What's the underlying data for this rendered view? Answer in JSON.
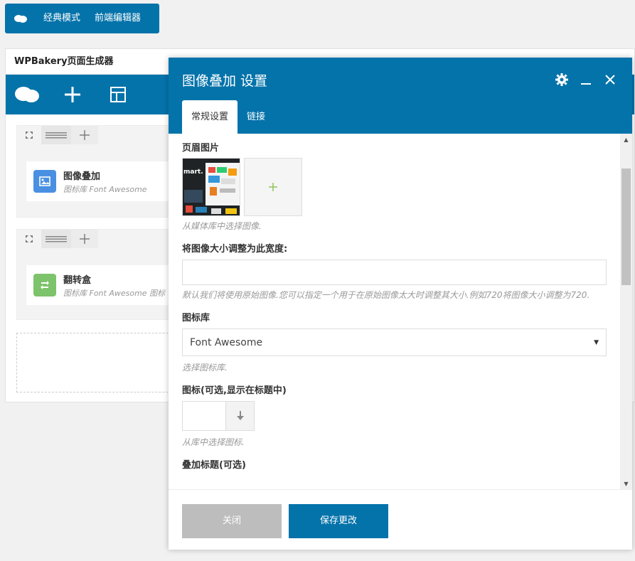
{
  "mode_bar": {
    "classic_label": "经典模式",
    "frontend_label": "前端编辑器"
  },
  "builder": {
    "title": "WPBakery页面生成器",
    "rows": [
      {
        "element_name": "图像叠加",
        "element_sub": "图标库 Font Awesome",
        "icon_color": "#4a90e2"
      },
      {
        "element_name": "翻转盒",
        "element_sub": "图标库 Font Awesome 图标",
        "icon_color": "#7dc36b"
      }
    ]
  },
  "modal": {
    "title": "图像叠加 设置",
    "tabs": [
      "常规设置",
      "链接"
    ],
    "fields": {
      "header_image_label": "页眉图片",
      "header_image_help": "从媒体库中选择图像.",
      "resize_label": "将图像大小调整为此宽度:",
      "resize_help": "默认我们将使用原始图像.您可以指定一个用于在原始图像太大时调整其大小.例如720将图像大小调整为720.",
      "icon_lib_label": "图标库",
      "icon_lib_value": "Font Awesome",
      "icon_lib_help": "选择图标库.",
      "icon_label": "图标(可选,显示在标题中)",
      "icon_help": "从库中选择图标.",
      "overlay_title_label": "叠加标题(可选)",
      "thumb_text": "mart."
    },
    "buttons": {
      "close": "关闭",
      "save": "保存更改"
    }
  },
  "colors": {
    "brand": "#0473aa",
    "add_plus": "#8cc152"
  }
}
